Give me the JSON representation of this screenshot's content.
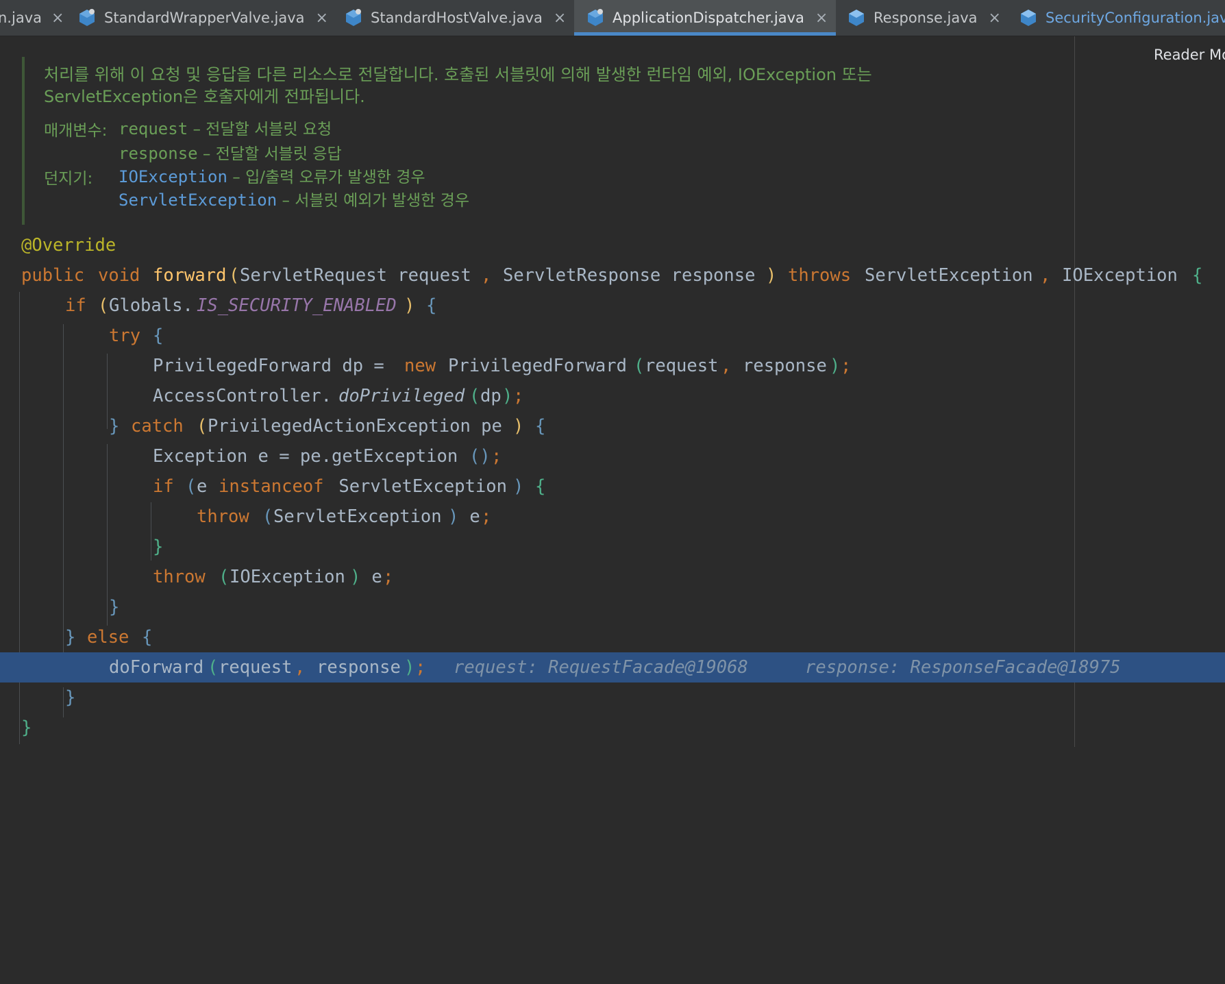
{
  "tabs": [
    {
      "label": "n.java",
      "icon": "java-class-icon",
      "active": false
    },
    {
      "label": "StandardWrapperValve.java",
      "icon": "java-class-icon",
      "active": false
    },
    {
      "label": "StandardHostValve.java",
      "icon": "java-class-icon",
      "active": false
    },
    {
      "label": "ApplicationDispatcher.java",
      "icon": "java-class-icon",
      "active": true
    },
    {
      "label": "Response.java",
      "icon": "java-interface-icon",
      "active": false
    },
    {
      "label": "SecurityConfiguration.jav",
      "icon": "java-interface-icon",
      "active": false
    }
  ],
  "close_glyph": "×",
  "reader_mode": "Reader Mo",
  "javadoc": {
    "description": "처리를 위해 이 요청 및 응답을 다른 리소스로 전달합니다. 호출된 서블릿에 의해 발생한 런타임 예외, IOException 또는 ServletException은 호출자에게 전파됩니다.",
    "params_label": "매개변수:",
    "params": [
      {
        "name": "request",
        "desc": " – 전달할 서블릿 요청"
      },
      {
        "name": "response",
        "desc": " – 전달할 서블릿 응답"
      }
    ],
    "throws_label": "던지기:",
    "throws": [
      {
        "name": "IOException",
        "desc": " – 입/출력 오류가 발생한 경우"
      },
      {
        "name": "ServletException",
        "desc": " – 서블릿 예외가 발생한 경우"
      }
    ]
  },
  "code": {
    "annotation": "@Override",
    "sig": {
      "public": "public",
      "void": "void",
      "name": "forward",
      "open": "(",
      "type1": "ServletRequest request",
      "comma": ",",
      "type2": "ServletResponse response",
      "close": ")",
      "throws": "throws",
      "ex1": "ServletException",
      "ex2": "IOException",
      "brace": "{"
    },
    "if1": {
      "kw": "if",
      "open": "(",
      "obj": "Globals.",
      "const": "IS_SECURITY_ENABLED",
      "close": ")",
      "brace": "{"
    },
    "try": {
      "kw": "try",
      "brace": "{"
    },
    "l4": {
      "type": "PrivilegedForward dp = ",
      "new": "new",
      "ctor": "PrivilegedForward",
      "open": "(",
      "a1": "request",
      "comma": ",",
      "a2": "response",
      "close": ")",
      "semi": ";"
    },
    "l5": {
      "obj": "AccessController.",
      "method": "doPrivileged",
      "open": "(",
      "arg": "dp",
      "close": ")",
      "semi": ";"
    },
    "l6": {
      "close": "}",
      "catch": "catch",
      "open": "(",
      "param": "PrivilegedActionException pe",
      "pclose": ")",
      "brace": "{"
    },
    "l7": {
      "text": "Exception e = pe.getException",
      "parens": "()",
      "semi": ";"
    },
    "l8": {
      "kw": "if",
      "open": "(",
      "e": "e ",
      "instanceof": "instanceof",
      "type": " ServletException",
      "close": ")",
      "brace": "{"
    },
    "l9": {
      "kw": "throw",
      "open": "(",
      "type": "ServletException",
      "close": ")",
      "rest": " e",
      "semi": ";"
    },
    "l10": {
      "brace": "}"
    },
    "l11": {
      "kw": "throw",
      "open": "(",
      "type": "IOException",
      "close": ")",
      "rest": " e",
      "semi": ";"
    },
    "l12": {
      "brace": "}"
    },
    "l13": {
      "close": "}",
      "else": "else",
      "brace": "{"
    },
    "l14": {
      "method": "doForward",
      "open": "(",
      "a1": "request",
      "comma": ",",
      "a2": "response",
      "close": ")",
      "semi": ";",
      "hint1": "request: RequestFacade@19068",
      "hint2": "response: ResponseFacade@18975"
    },
    "l15": {
      "brace": "}"
    },
    "l16": {
      "brace": "}"
    }
  },
  "colors": {
    "background": "#2b2b2b",
    "highlight": "#2d5183",
    "keyword": "#cc7832",
    "method": "#ffc66d",
    "doc": "#6a9e57",
    "doc_link": "#5c9bd8",
    "active_tab_underline": "#4a88c7"
  }
}
